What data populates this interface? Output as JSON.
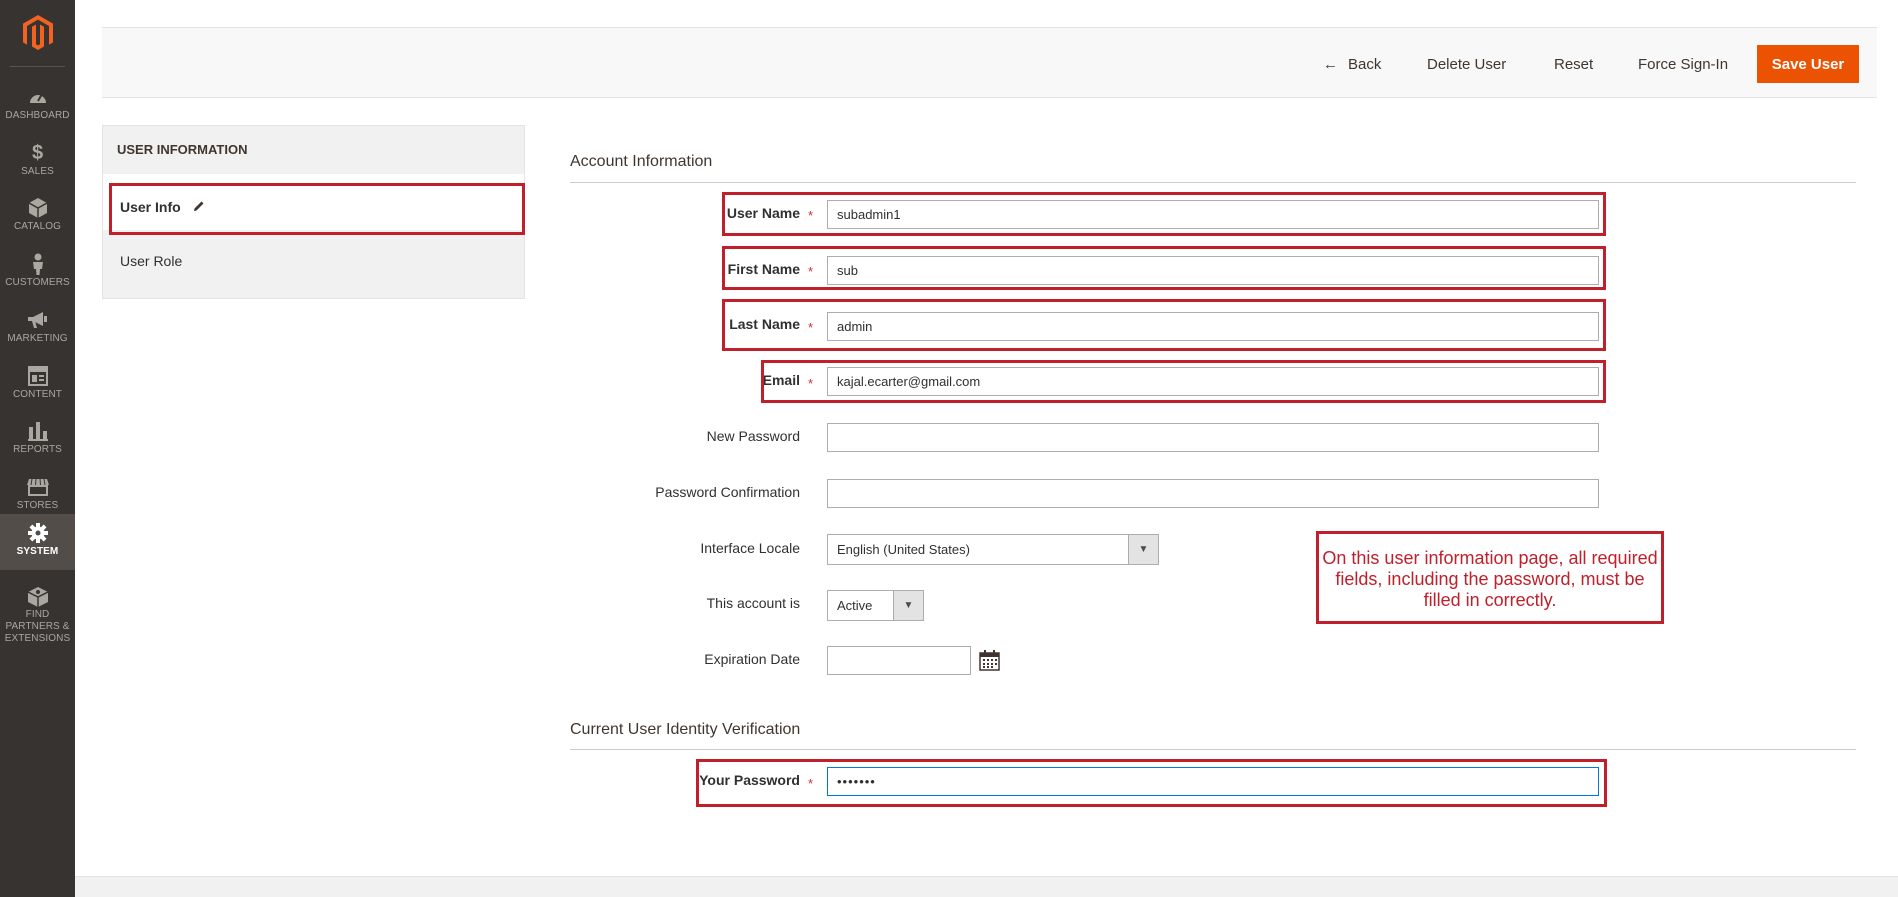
{
  "sidebar": {
    "logo": "magento-logo",
    "items": [
      {
        "label": "DASHBOARD",
        "icon": "dashboard-icon"
      },
      {
        "label": "SALES",
        "icon": "dollar-icon"
      },
      {
        "label": "CATALOG",
        "icon": "cube-icon"
      },
      {
        "label": "CUSTOMERS",
        "icon": "person-icon"
      },
      {
        "label": "MARKETING",
        "icon": "megaphone-icon"
      },
      {
        "label": "CONTENT",
        "icon": "layout-icon"
      },
      {
        "label": "REPORTS",
        "icon": "bar-chart-icon"
      },
      {
        "label": "STORES",
        "icon": "store-icon"
      },
      {
        "label": "SYSTEM",
        "icon": "gear-icon",
        "active": true
      },
      {
        "label": "FIND PARTNERS & EXTENSIONS",
        "icon": "box-icon"
      }
    ]
  },
  "actions": {
    "back": "Back",
    "delete": "Delete User",
    "reset": "Reset",
    "force_signin": "Force Sign-In",
    "save": "Save User"
  },
  "tabs": {
    "title": "USER INFORMATION",
    "user_info": "User Info",
    "user_role": "User Role"
  },
  "account": {
    "title": "Account Information",
    "username_label": "User Name",
    "username_value": "subadmin1",
    "firstname_label": "First Name",
    "firstname_value": "sub",
    "lastname_label": "Last Name",
    "lastname_value": "admin",
    "email_label": "Email",
    "email_value": "kajal.ecarter@gmail.com",
    "new_password_label": "New Password",
    "new_password_value": "",
    "password_confirm_label": "Password Confirmation",
    "password_confirm_value": "",
    "locale_label": "Interface Locale",
    "locale_value": "English (United States)",
    "status_label": "This account is",
    "status_value": "Active",
    "expiration_label": "Expiration Date",
    "expiration_value": ""
  },
  "verification": {
    "title": "Current User Identity Verification",
    "password_label": "Your Password",
    "password_value": "•••••••"
  },
  "required_marker": "*",
  "callout": "On this user information page, all required fields, including the password, must be filled in correctly.",
  "colors": {
    "sidebar": "#373330",
    "accent": "#eb5202",
    "annotation": "#c0202b",
    "required": "#e02b27"
  }
}
